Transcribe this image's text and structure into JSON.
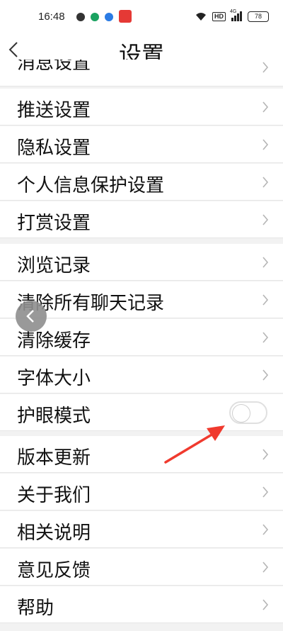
{
  "status": {
    "time": "16:48",
    "network": "4G",
    "hd": "HD",
    "battery": "78"
  },
  "header": {
    "title": "设置"
  },
  "rows": [
    {
      "label": "消息设置"
    },
    {
      "label": "推送设置"
    },
    {
      "label": "隐私设置"
    },
    {
      "label": "个人信息保护设置"
    },
    {
      "label": "打赏设置"
    },
    {
      "label": "浏览记录"
    },
    {
      "label": "清除所有聊天记录"
    },
    {
      "label": "清除缓存"
    },
    {
      "label": "字体大小"
    },
    {
      "label": "护眼模式",
      "toggle": false
    },
    {
      "label": "版本更新"
    },
    {
      "label": "关于我们"
    },
    {
      "label": "相关说明"
    },
    {
      "label": "意见反馈"
    },
    {
      "label": "帮助"
    }
  ]
}
